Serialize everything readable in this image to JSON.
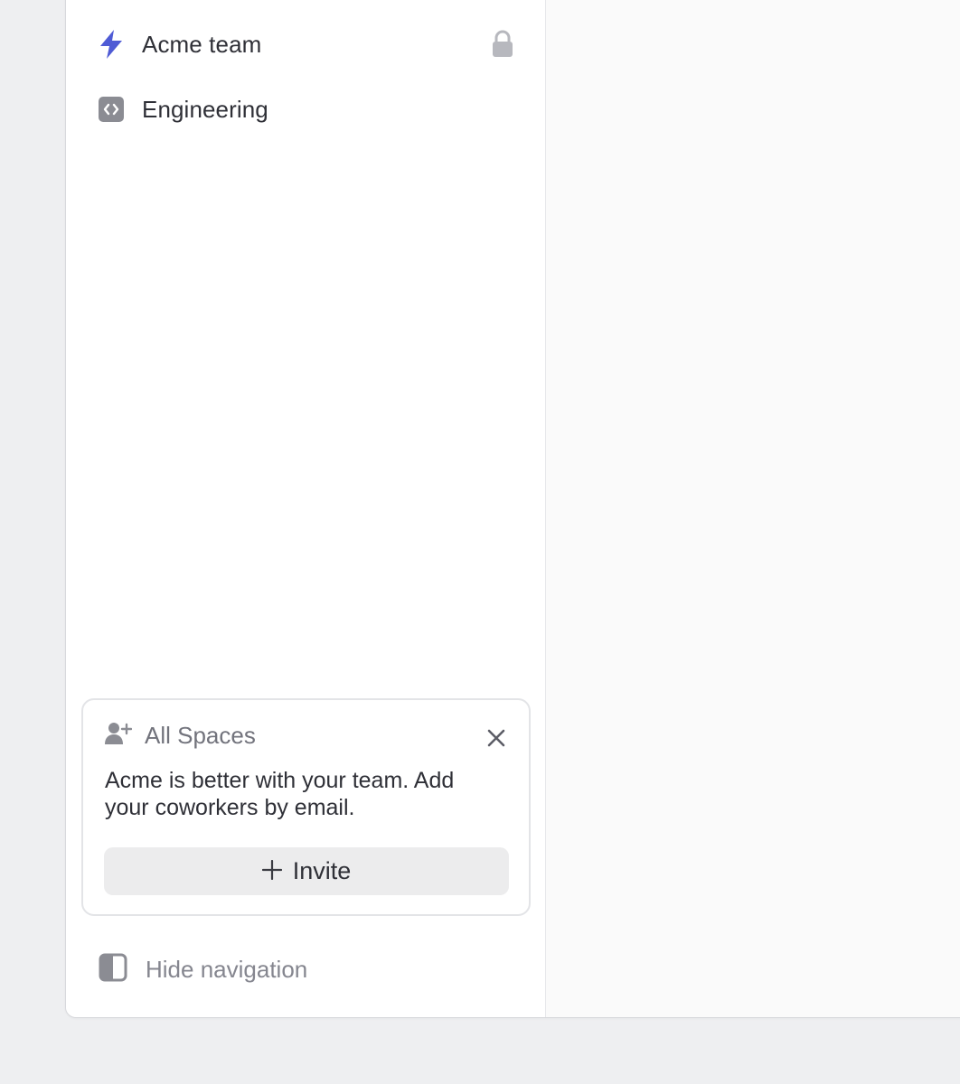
{
  "sidebar": {
    "items": [
      {
        "label": "Acme team",
        "icon": "lightning-icon",
        "locked": true,
        "icon_color": "#4f5bd5"
      },
      {
        "label": "Engineering",
        "icon": "code-icon",
        "locked": false
      }
    ],
    "invite_card": {
      "icon": "add-user-icon",
      "title": "All Spaces",
      "body": "Acme is better with your team. Add your coworkers by email.",
      "button_label": "Invite",
      "close_icon": "close-icon"
    },
    "hide_navigation": {
      "label": "Hide navigation",
      "icon": "sidebar-toggle-icon"
    }
  },
  "colors": {
    "accent": "#4f5bd5",
    "text_primary": "#2f3037",
    "text_secondary": "#72737c",
    "button_bg": "#ececed",
    "page_bg": "#eeeff1"
  }
}
